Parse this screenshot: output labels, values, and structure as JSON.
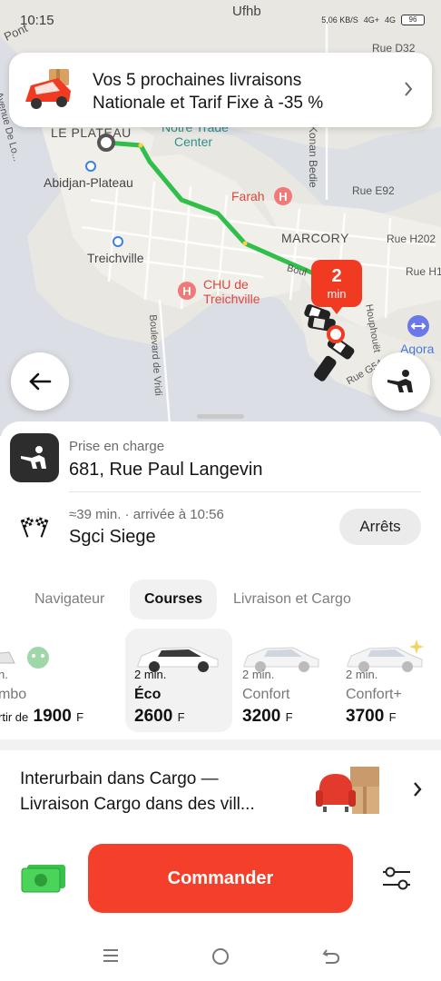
{
  "status_bar": {
    "time": "10:15",
    "network": "5,06 KB/S",
    "signal_1": "4G+",
    "signal_2": "4G",
    "battery": "96"
  },
  "promo": {
    "line1": "Vos 5 prochaines livraisons",
    "line2": "Nationale et Tarif Fixe à -35 %"
  },
  "map": {
    "labels": {
      "pont": "Pont",
      "ufhb": "Ufhb",
      "rue_d32": "Rue D32",
      "le_plateau": "LE PLATEAU",
      "notre_trade": "Notre Trade",
      "center": "Center",
      "abidjan_plateau": "Abidjan-Plateau",
      "avenue_lo": "Avenue De Lo...",
      "konan_bedie": "Konan Bedie",
      "farah": "Farah",
      "rue_e92": "Rue E92",
      "marcory": "MARCORY",
      "rue_h202": "Rue H202",
      "rue_h1": "Rue H1",
      "treichville": "Treichville",
      "chu_1": "CHU de",
      "chu_2": "Treichville",
      "boulevard_vridi": "Boulevard de Vridi",
      "houphouet": "Houphouët",
      "boule": "Boul",
      "rue_g54": "Rue G54",
      "agora": "Agora"
    },
    "eta_badge": {
      "number": "2",
      "unit": "min"
    }
  },
  "route": {
    "pickup_label": "Prise en charge",
    "pickup_address": "681, Rue Paul Langevin",
    "dest_meta": "≈39 min. · arrivée à 10:56",
    "dest_name": "Sgci Siege",
    "stops_button": "Arrêts"
  },
  "tabs": [
    {
      "label": "Navigateur",
      "active": false
    },
    {
      "label": "Courses",
      "active": true
    },
    {
      "label": "Livraison et Cargo",
      "active": false
    }
  ],
  "tariffs": [
    {
      "eta": "n.",
      "name": "mbo",
      "price_prefix": "rtir de",
      "price": "1900",
      "currency": "F",
      "active": false
    },
    {
      "eta": "2 min.",
      "name": "Éco",
      "price_prefix": "",
      "price": "2600",
      "currency": "F",
      "active": true
    },
    {
      "eta": "2 min.",
      "name": "Confort",
      "price_prefix": "",
      "price": "3200",
      "currency": "F",
      "active": false
    },
    {
      "eta": "2 min.",
      "name": "Confort+",
      "price_prefix": "",
      "price": "3700",
      "currency": "F",
      "active": false
    }
  ],
  "cargo": {
    "line1": "Interurbain dans Cargo —",
    "line2": "Livraison Cargo dans des vill..."
  },
  "actions": {
    "order_button": "Commander"
  },
  "colors": {
    "accent": "#f4402a",
    "route_green": "#2fbf4a",
    "map_bg": "#e9e7e2"
  }
}
